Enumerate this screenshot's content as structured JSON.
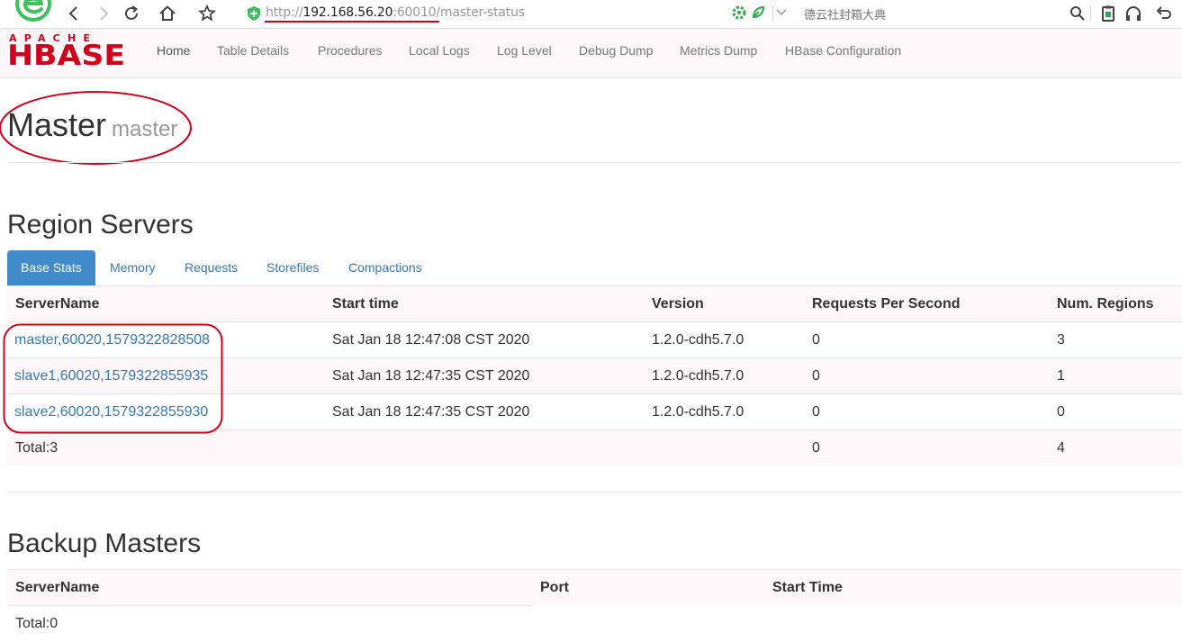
{
  "browser": {
    "url_scheme": "http://",
    "url_host": "192.168.56.20",
    "url_port": ":60010",
    "url_path": "/master-status",
    "search_hint": "德云社封箱大典"
  },
  "nav": {
    "logo_top": "APACHE",
    "logo_main": "HBASE",
    "items": [
      "Home",
      "Table Details",
      "Procedures",
      "Local Logs",
      "Log Level",
      "Debug Dump",
      "Metrics Dump",
      "HBase Configuration"
    ]
  },
  "header": {
    "title": "Master",
    "subtitle": "master"
  },
  "region_servers": {
    "title": "Region Servers",
    "tabs": [
      "Base Stats",
      "Memory",
      "Requests",
      "Storefiles",
      "Compactions"
    ],
    "active_tab": "Base Stats",
    "columns": [
      "ServerName",
      "Start time",
      "Version",
      "Requests Per Second",
      "Num. Regions"
    ],
    "rows": [
      [
        "master,60020,1579322828508",
        "Sat Jan 18 12:47:08 CST 2020",
        "1.2.0-cdh5.7.0",
        "0",
        "3"
      ],
      [
        "slave1,60020,1579322855935",
        "Sat Jan 18 12:47:35 CST 2020",
        "1.2.0-cdh5.7.0",
        "0",
        "1"
      ],
      [
        "slave2,60020,1579322855930",
        "Sat Jan 18 12:47:35 CST 2020",
        "1.2.0-cdh5.7.0",
        "0",
        "0"
      ]
    ],
    "total": {
      "label": "Total:3",
      "requests": "0",
      "regions": "4"
    }
  },
  "backup_masters": {
    "title": "Backup Masters",
    "columns": [
      "ServerName",
      "Port",
      "Start Time"
    ],
    "total_label": "Total:0"
  },
  "colors": {
    "annotation": "#d0021b",
    "link": "#337ab7",
    "active_tab": "#428bca"
  }
}
